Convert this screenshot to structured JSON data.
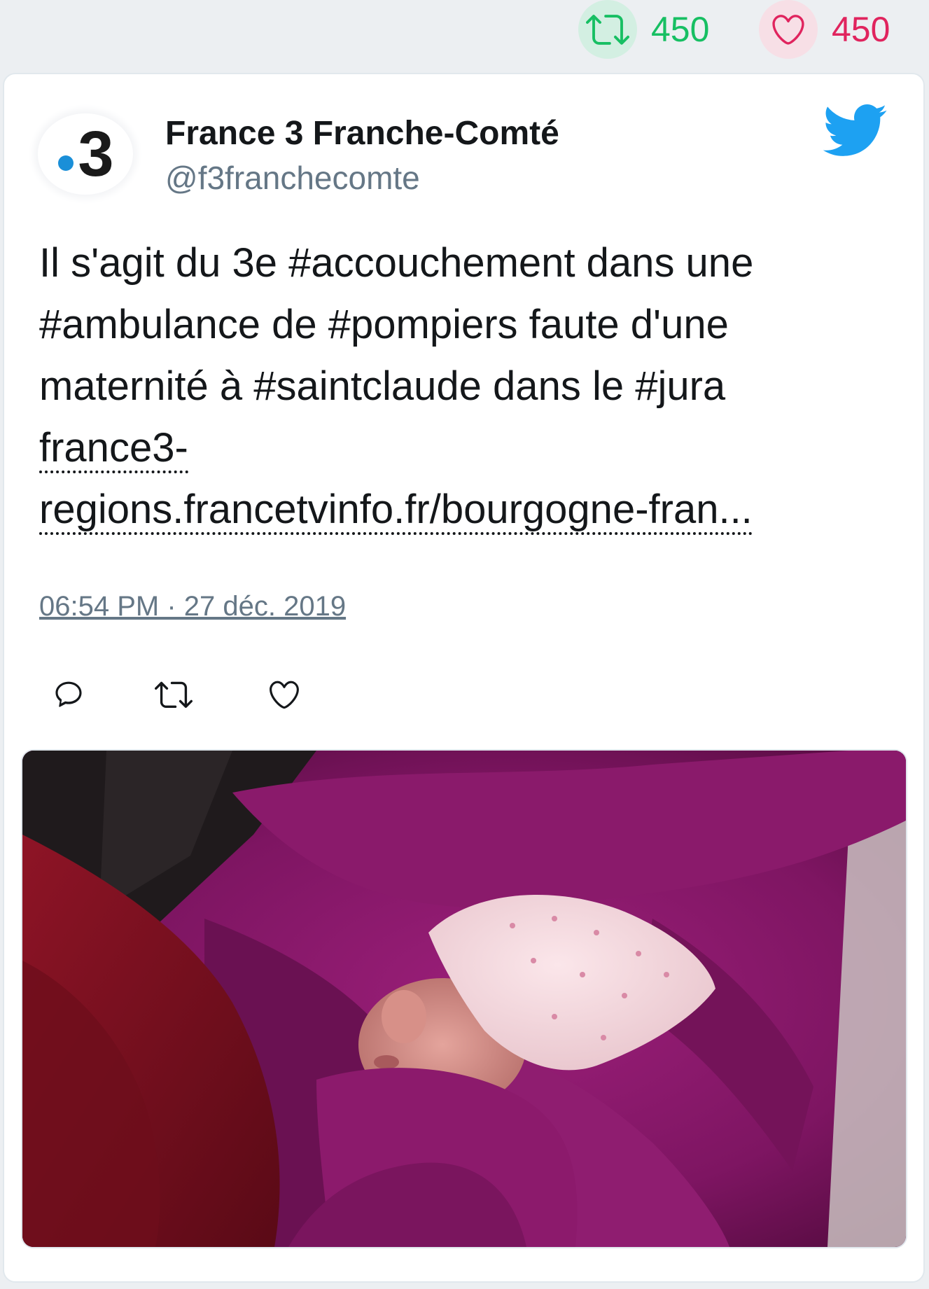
{
  "stats": {
    "retweets": "450",
    "likes": "450",
    "retweet_icon": "retweet-icon",
    "like_icon": "heart-icon"
  },
  "tweet": {
    "author_name": "France 3 Franche-Comté",
    "author_handle": "@f3franchecomte",
    "avatar_text": "3",
    "text_lines": [
      "Il s'agit du 3e #accouchement dans une",
      "#ambulance de #pompiers faute d'une",
      "maternité à #saintclaude dans le #jura"
    ],
    "link_lines": [
      "france3-",
      "regions.francetvinfo.fr/bourgogne-fran..."
    ],
    "timestamp": "06:54 PM · 27 déc. 2019",
    "media_icon": "newborn-photo"
  },
  "colors": {
    "retweet": "#17bf63",
    "like": "#e0245e",
    "twitter_blue": "#1da1f2",
    "secondary_text": "#657786"
  }
}
